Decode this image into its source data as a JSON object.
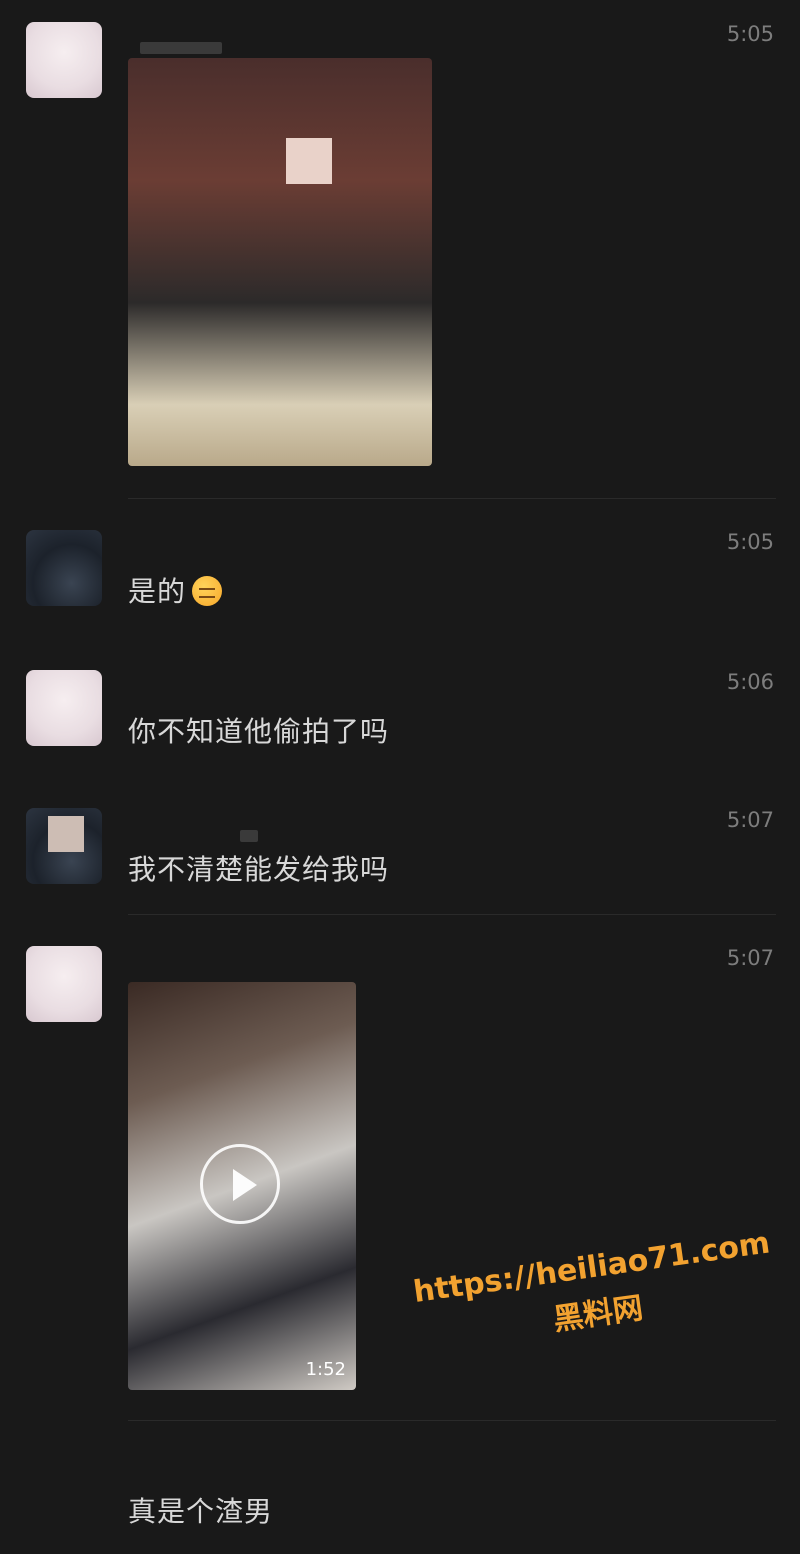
{
  "messages": [
    {
      "sender": "girl",
      "time": "5:05",
      "type": "image"
    },
    {
      "sender": "other",
      "time": "5:05",
      "type": "text",
      "text": "是的"
    },
    {
      "sender": "girl",
      "time": "5:06",
      "type": "text",
      "text": "你不知道他偷拍了吗"
    },
    {
      "sender": "other",
      "time": "5:07",
      "type": "text",
      "text": "我不清楚能发给我吗"
    },
    {
      "sender": "girl",
      "time": "5:07",
      "type": "video",
      "duration": "1:52"
    },
    {
      "sender": "other",
      "time": "",
      "type": "text",
      "text": "真是个渣男"
    }
  ],
  "watermark": {
    "url": "https://heiliao71.com",
    "name": "黑料网",
    "color": "#f2a230"
  },
  "icons": {
    "play": "play-icon",
    "emoji": "pensive-face-emoji"
  }
}
